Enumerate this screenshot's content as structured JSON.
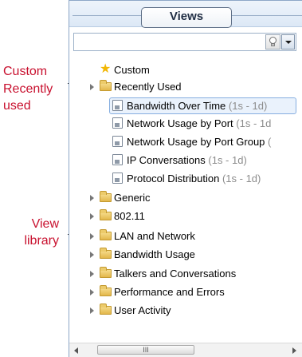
{
  "annotations": {
    "custom": "Custom",
    "recently_used_1": "Recently",
    "recently_used_2": "used",
    "view_library_1": "View",
    "view_library_2": "library"
  },
  "panel": {
    "title": "Views",
    "search_placeholder": ""
  },
  "tree": {
    "custom": "Custom",
    "recently_used": "Recently Used",
    "recent_items": [
      {
        "name": "Bandwidth Over Time",
        "range": "(1s - 1d)"
      },
      {
        "name": "Network Usage by Port",
        "range": "(1s - 1d"
      },
      {
        "name": "Network Usage by Port Group",
        "range": "("
      },
      {
        "name": "IP Conversations",
        "range": "(1s - 1d)"
      },
      {
        "name": "Protocol Distribution",
        "range": "(1s - 1d)"
      }
    ],
    "library": [
      "Generic",
      "802.11",
      "LAN and Network",
      "Bandwidth Usage",
      "Talkers and Conversations",
      "Performance and Errors",
      "User Activity"
    ]
  },
  "scrollbar": {
    "grip": "III"
  },
  "colors": {
    "annotation": "#c8102e",
    "selection_border": "#86aee0",
    "panel_border": "#8ea7c7"
  }
}
